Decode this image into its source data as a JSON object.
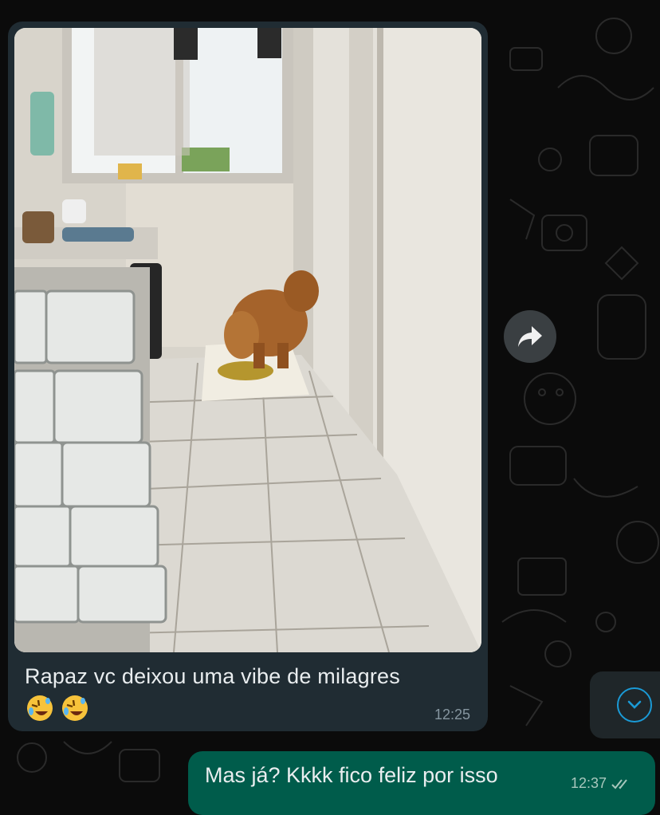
{
  "message_in": {
    "caption": "Rapaz vc deixou uma vibe de milagres",
    "emojis": [
      "rolling-on-floor-laughing",
      "rolling-on-floor-laughing"
    ],
    "time": "12:25"
  },
  "message_out": {
    "text": "Mas já? Kkkk fico feliz por isso",
    "time": "12:37",
    "status": "read-double-check"
  },
  "icons": {
    "forward": "forward-arrow-icon",
    "scroll_down": "chevron-down-icon"
  },
  "colors": {
    "incoming_bubble": "#202c33",
    "outgoing_bubble": "#005c4b",
    "accent": "#1a9ad6",
    "background": "#0b0b0b"
  }
}
